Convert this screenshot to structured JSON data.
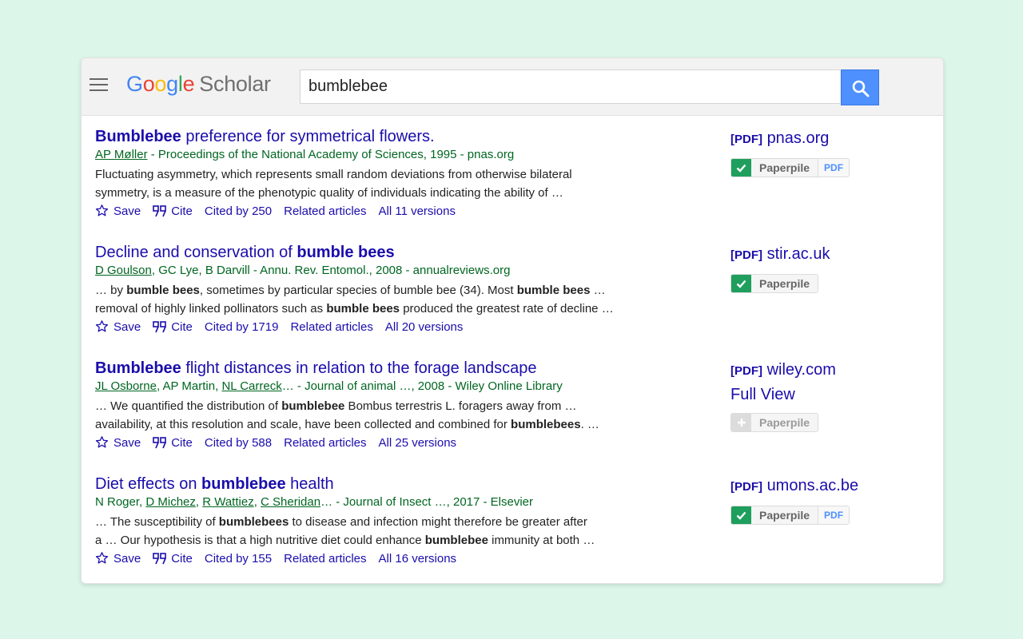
{
  "header": {
    "logo_google": "Google",
    "logo_scholar": "Scholar",
    "search_value": "bumblebee"
  },
  "results": [
    {
      "title": [
        {
          "t": "Bumblebee",
          "b": true
        },
        {
          "t": " preference for symmetrical flowers.",
          "b": false
        }
      ],
      "byline": [
        {
          "t": "AP Møller",
          "u": true
        },
        {
          "t": " - Proceedings of the National Academy of Sciences, 1995 - pnas.org",
          "u": false
        }
      ],
      "snippet1": [
        {
          "t": "Fluctuating asymmetry, which represents small random deviations from otherwise bilateral",
          "b": false
        }
      ],
      "snippet2": [
        {
          "t": "symmetry, is a measure of the phenotypic quality of individuals indicating the ability of …",
          "b": false
        }
      ],
      "save": "Save",
      "cite": "Cite",
      "cited_by": "Cited by 250",
      "related": "Related articles",
      "versions": "All 11 versions",
      "side": {
        "tag": "[PDF]",
        "domain": "pnas.org",
        "full_view": "",
        "paperpile": "Paperpile",
        "paperpile_added": true,
        "pdf_badge": "PDF"
      }
    },
    {
      "title": [
        {
          "t": "Decline and conservation of ",
          "b": false
        },
        {
          "t": "bumble bees",
          "b": true
        }
      ],
      "byline": [
        {
          "t": "D Goulson",
          "u": true
        },
        {
          "t": ", GC Lye, B Darvill - Annu. Rev. Entomol., 2008 - annualreviews.org",
          "u": false
        }
      ],
      "snippet1": [
        {
          "t": "… by ",
          "b": false
        },
        {
          "t": "bumble bees",
          "b": true
        },
        {
          "t": ", sometimes by particular species of bumble bee (34). Most ",
          "b": false
        },
        {
          "t": "bumble bees",
          "b": true
        },
        {
          "t": " …",
          "b": false
        }
      ],
      "snippet2": [
        {
          "t": "removal of highly linked pollinators such as ",
          "b": false
        },
        {
          "t": "bumble bees",
          "b": true
        },
        {
          "t": " produced the greatest rate of decline …",
          "b": false
        }
      ],
      "save": "Save",
      "cite": "Cite",
      "cited_by": "Cited by 1719",
      "related": "Related articles",
      "versions": "All 20 versions",
      "side": {
        "tag": "[PDF]",
        "domain": "stir.ac.uk",
        "full_view": "",
        "paperpile": "Paperpile",
        "paperpile_added": true,
        "pdf_badge": ""
      }
    },
    {
      "title": [
        {
          "t": "Bumblebee",
          "b": true
        },
        {
          "t": " flight distances in relation to the forage landscape",
          "b": false
        }
      ],
      "byline": [
        {
          "t": "JL Osborne",
          "u": true
        },
        {
          "t": ", AP Martin, ",
          "u": false
        },
        {
          "t": "NL Carreck",
          "u": true
        },
        {
          "t": "… - Journal of animal …, 2008 - Wiley Online Library",
          "u": false
        }
      ],
      "snippet1": [
        {
          "t": "… We quantified the distribution of ",
          "b": false
        },
        {
          "t": "bumblebee",
          "b": true
        },
        {
          "t": " Bombus terrestris L. foragers away from …",
          "b": false
        }
      ],
      "snippet2": [
        {
          "t": "availability, at this resolution and scale, have been collected and combined for ",
          "b": false
        },
        {
          "t": "bumblebees",
          "b": true
        },
        {
          "t": ". …",
          "b": false
        }
      ],
      "save": "Save",
      "cite": "Cite",
      "cited_by": "Cited by 588",
      "related": "Related articles",
      "versions": "All 25 versions",
      "side": {
        "tag": "[PDF]",
        "domain": "wiley.com",
        "full_view": "Full View",
        "paperpile": "Paperpile",
        "paperpile_added": false,
        "pdf_badge": ""
      }
    },
    {
      "title": [
        {
          "t": "Diet effects on ",
          "b": false
        },
        {
          "t": "bumblebee",
          "b": true
        },
        {
          "t": " health",
          "b": false
        }
      ],
      "byline": [
        {
          "t": "N Roger, ",
          "u": false
        },
        {
          "t": "D Michez",
          "u": true
        },
        {
          "t": ", ",
          "u": false
        },
        {
          "t": "R Wattiez",
          "u": true
        },
        {
          "t": ", ",
          "u": false
        },
        {
          "t": "C Sheridan",
          "u": true
        },
        {
          "t": "… - Journal of Insect …, 2017 - Elsevier",
          "u": false
        }
      ],
      "snippet1": [
        {
          "t": "… The susceptibility of ",
          "b": false
        },
        {
          "t": "bumblebees",
          "b": true
        },
        {
          "t": " to disease and infection might therefore be greater after",
          "b": false
        }
      ],
      "snippet2": [
        {
          "t": "a … Our hypothesis is that a high nutritive diet could enhance ",
          "b": false
        },
        {
          "t": "bumblebee",
          "b": true
        },
        {
          "t": " immunity at both …",
          "b": false
        }
      ],
      "save": "Save",
      "cite": "Cite",
      "cited_by": "Cited by 155",
      "related": "Related articles",
      "versions": "All 16 versions",
      "side": {
        "tag": "[PDF]",
        "domain": "umons.ac.be",
        "full_view": "",
        "paperpile": "Paperpile",
        "paperpile_added": true,
        "pdf_badge": "PDF"
      }
    }
  ],
  "colors": {
    "link": "#1a0dab",
    "byline": "#006621",
    "accent": "#4d90fe",
    "paperpile_green": "#1e9f5d",
    "background": "#dcf7ea"
  }
}
